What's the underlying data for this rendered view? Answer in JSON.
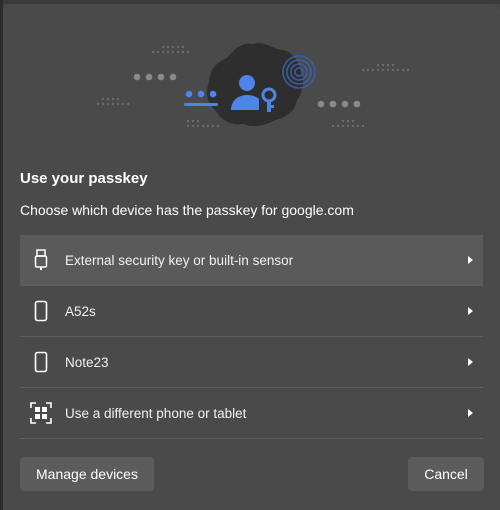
{
  "dialog": {
    "title": "Use your passkey",
    "subtitle": "Choose which device has the passkey for google.com"
  },
  "devices": [
    {
      "label": "External security key or built-in sensor",
      "icon": "usb-key-icon",
      "selected": true
    },
    {
      "label": "A52s",
      "icon": "phone-icon",
      "selected": false
    },
    {
      "label": "Note23",
      "icon": "phone-icon",
      "selected": false
    },
    {
      "label": "Use a different phone or tablet",
      "icon": "qr-code-icon",
      "selected": false
    }
  ],
  "buttons": {
    "manage_devices": "Manage devices",
    "cancel": "Cancel"
  },
  "colors": {
    "accent": "#4e84e8",
    "dialog_bg": "#4a4a4a",
    "button_bg": "#5c5c5c",
    "selected_row_bg": "#5a5a5a"
  }
}
